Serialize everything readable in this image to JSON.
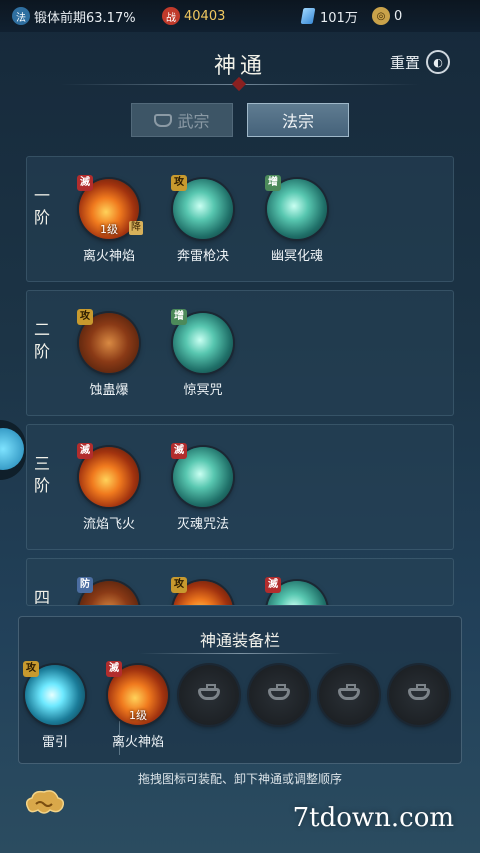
{
  "status_bar": {
    "cultivation": "锻体前期63.17%",
    "cultivation_icon": "法",
    "power": "40403",
    "power_icon": "战",
    "spirit_stone": "101万",
    "coin": "0"
  },
  "header": {
    "title": "神通",
    "reset_label": "重置"
  },
  "tabs": [
    {
      "label": "武宗",
      "active": false
    },
    {
      "label": "法宗",
      "active": true
    }
  ],
  "tiers": [
    {
      "label": "一阶",
      "skills": [
        {
          "name": "离火神焰",
          "tag": "滅",
          "level": "1级",
          "corner": "降",
          "style": "fire"
        },
        {
          "name": "奔雷枪决",
          "tag": "攻",
          "style": "teal"
        },
        {
          "name": "幽冥化魂",
          "tag": "增",
          "style": "teal"
        }
      ]
    },
    {
      "label": "二阶",
      "skills": [
        {
          "name": "蚀蛊爆",
          "tag": "攻",
          "style": "fire2"
        },
        {
          "name": "惊冥咒",
          "tag": "增",
          "style": "teal"
        }
      ]
    },
    {
      "label": "三阶",
      "skills": [
        {
          "name": "流焰飞火",
          "tag": "滅",
          "style": "fire"
        },
        {
          "name": "灭魂咒法",
          "tag": "滅",
          "style": "teal"
        }
      ]
    },
    {
      "label": "四",
      "skills": [
        {
          "tag": "防",
          "style": "fire2"
        },
        {
          "tag": "攻",
          "style": "fire"
        },
        {
          "tag": "滅",
          "style": "teal"
        }
      ]
    }
  ],
  "equip_bar": {
    "title": "神通装备栏",
    "main": {
      "name": "雷引",
      "tag": "攻"
    },
    "slots": [
      {
        "name": "离火神焰",
        "tag": "滅",
        "level": "1级"
      }
    ]
  },
  "hint": "拖拽图标可装配、卸下神通或调整顺序",
  "watermark": "7tdown.com"
}
